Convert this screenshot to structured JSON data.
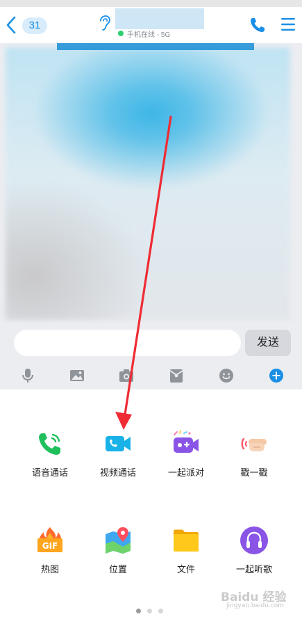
{
  "header": {
    "unread_count": "31",
    "status_text": "手机在线 - 5G",
    "icons": {
      "back": "chevron-left-icon",
      "ear": "ear-icon",
      "phone": "phone-icon",
      "menu": "menu-icon"
    },
    "accent": "#1a8fe6",
    "online_color": "#2fd06f"
  },
  "input_bar": {
    "message_value": "",
    "send_label": "发送"
  },
  "toolbar": {
    "items": [
      "microphone-icon",
      "picture-icon",
      "camera-icon",
      "red-packet-icon",
      "emoji-icon",
      "plus-icon"
    ]
  },
  "panel": {
    "items": [
      {
        "label": "语音通话",
        "icon": "voice-call-icon"
      },
      {
        "label": "视频通话",
        "icon": "video-call-icon"
      },
      {
        "label": "一起派对",
        "icon": "party-icon"
      },
      {
        "label": "戳一戳",
        "icon": "poke-icon"
      },
      {
        "label": "热图",
        "icon": "gif-icon"
      },
      {
        "label": "位置",
        "icon": "location-icon"
      },
      {
        "label": "文件",
        "icon": "folder-icon"
      },
      {
        "label": "一起听歌",
        "icon": "headphones-icon"
      }
    ],
    "page_count": 3,
    "current_page": 1
  },
  "watermark": {
    "text": "Baidu 经验",
    "sub": "jingyan.baidu.com"
  }
}
